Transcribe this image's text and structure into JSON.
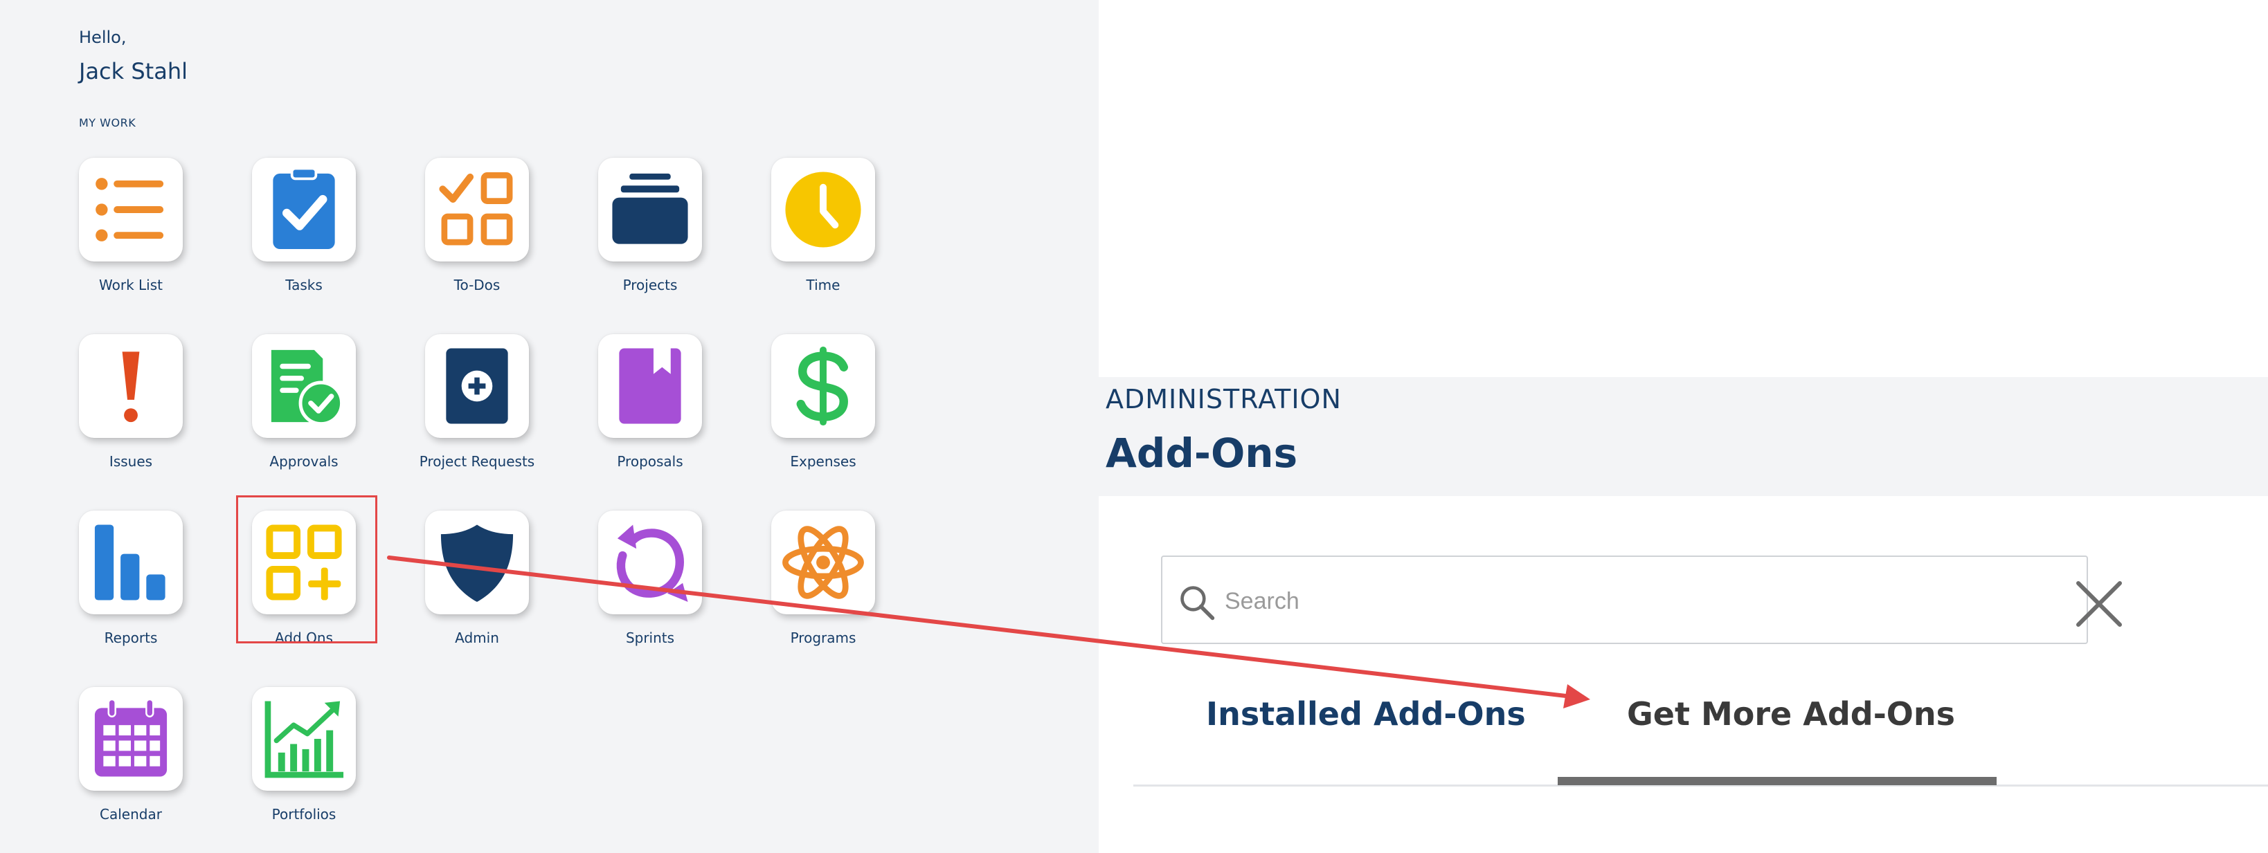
{
  "greeting": "Hello,",
  "user_name": "Jack Stahl",
  "section_label": "MY WORK",
  "tiles": [
    {
      "label": "Work List",
      "icon": "work-list-icon"
    },
    {
      "label": "Tasks",
      "icon": "tasks-icon"
    },
    {
      "label": "To-Dos",
      "icon": "todos-icon"
    },
    {
      "label": "Projects",
      "icon": "projects-icon"
    },
    {
      "label": "Time",
      "icon": "clock-icon"
    },
    {
      "label": "Issues",
      "icon": "exclamation-icon"
    },
    {
      "label": "Approvals",
      "icon": "approvals-icon"
    },
    {
      "label": "Project Requests",
      "icon": "project-requests-icon"
    },
    {
      "label": "Proposals",
      "icon": "proposals-icon"
    },
    {
      "label": "Expenses",
      "icon": "dollar-icon"
    },
    {
      "label": "Reports",
      "icon": "bar-chart-icon"
    },
    {
      "label": "Add Ons",
      "icon": "add-ons-icon"
    },
    {
      "label": "Admin",
      "icon": "shield-icon"
    },
    {
      "label": "Sprints",
      "icon": "sprints-icon"
    },
    {
      "label": "Programs",
      "icon": "atom-icon"
    },
    {
      "label": "Calendar",
      "icon": "calendar-icon"
    },
    {
      "label": "Portfolios",
      "icon": "portfolios-icon"
    }
  ],
  "admin": {
    "kicker": "ADMINISTRATION",
    "title": "Add-Ons"
  },
  "search": {
    "placeholder": "Search",
    "value": ""
  },
  "tabs": [
    {
      "label": "Installed Add-Ons",
      "active": false
    },
    {
      "label": "Get More Add-Ons",
      "active": true
    }
  ],
  "colors": {
    "navy": "#173d68",
    "orange": "#ef8c2b",
    "blue": "#2a7fd6",
    "yellow": "#f7c600",
    "red": "#e14b1f",
    "green": "#2fbf58",
    "purple": "#a64fd6",
    "annotation_red": "#e34747"
  }
}
